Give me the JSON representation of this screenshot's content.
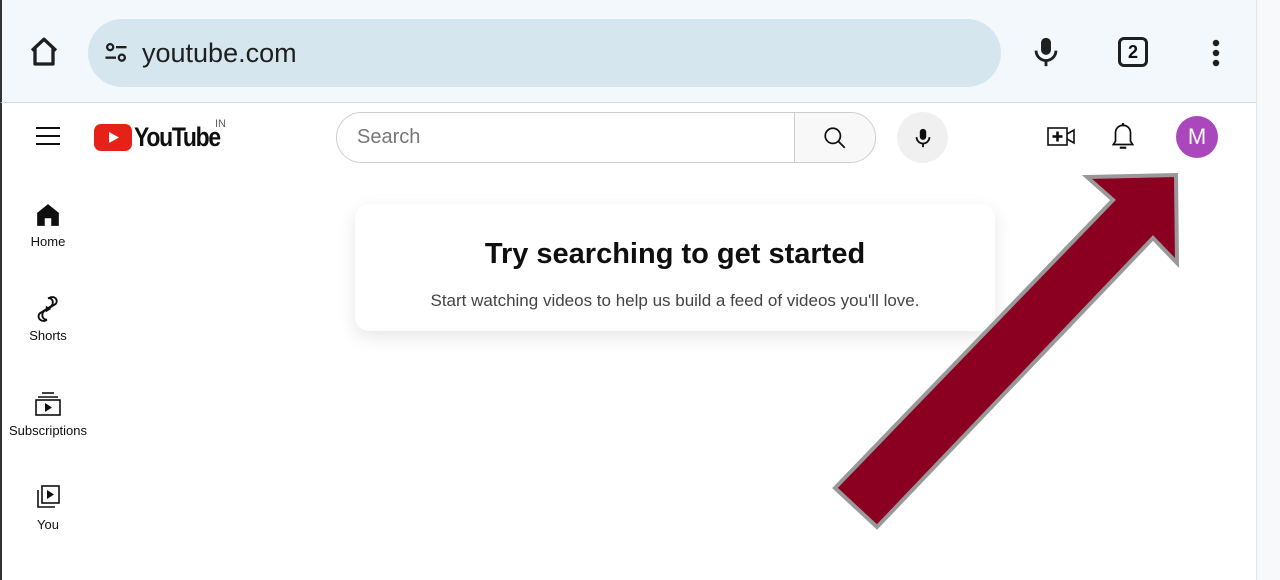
{
  "browser": {
    "url": "youtube.com",
    "tab_count": "2",
    "icons": [
      "home-icon",
      "site-settings-icon",
      "mic-icon",
      "tabs-icon",
      "more-vert-icon"
    ]
  },
  "header": {
    "logo": "YouTube",
    "region": "IN",
    "search_placeholder": "Search",
    "avatar_letter": "M",
    "avatar_color": "#ab47bc"
  },
  "sidebar": {
    "items": [
      {
        "label": "Home"
      },
      {
        "label": "Shorts"
      },
      {
        "label": "Subscriptions"
      },
      {
        "label": "You"
      }
    ]
  },
  "main": {
    "title": "Try searching to get started",
    "subtitle": "Start watching videos to help us build a feed of videos you'll love."
  },
  "annotation": {
    "arrow_color": "#8b0020",
    "arrow_outline": "#999999"
  }
}
